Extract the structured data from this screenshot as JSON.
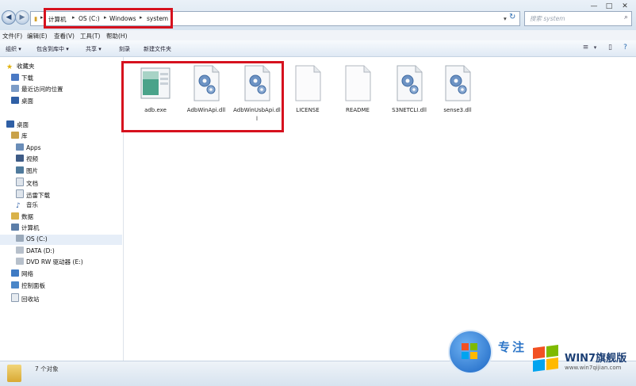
{
  "address": {
    "crumbs": [
      "计算机",
      "OS (C:)",
      "Windows",
      "system"
    ]
  },
  "search": {
    "placeholder": "搜索 system"
  },
  "menu": [
    "文件(F)",
    "编辑(E)",
    "查看(V)",
    "工具(T)",
    "帮助(H)"
  ],
  "toolbar": {
    "organize": "组织 ▾",
    "include": "包含到库中 ▾",
    "share": "共享 ▾",
    "burn": "刻录",
    "newfolder": "新建文件夹"
  },
  "sidebar": {
    "favorites": "收藏夹",
    "fav_items": [
      "下载",
      "最近访问的位置",
      "桌面"
    ],
    "desktop": "桌面",
    "libraries": "库",
    "lib_items": [
      "Apps",
      "视频",
      "图片",
      "文档",
      "迅雷下载",
      "音乐"
    ],
    "user": "数据",
    "computer": "计算机",
    "drives": [
      "OS (C:)",
      "DATA (D:)",
      "DVD RW 驱动器 (E:)"
    ],
    "network": "网络",
    "control_panel": "控制面板",
    "recycle": "回收站"
  },
  "files": [
    {
      "name": "adb.exe",
      "icon": "exe-app-icon"
    },
    {
      "name": "AdbWinApi.dll",
      "icon": "dll-gear-icon"
    },
    {
      "name": "AdbWinUsbApi.dll",
      "icon": "dll-gear-icon"
    },
    {
      "name": "LICENSE",
      "icon": "blank-file-icon"
    },
    {
      "name": "README",
      "icon": "blank-file-icon"
    },
    {
      "name": "S3NETCLI.dll",
      "icon": "dll-gear-icon"
    },
    {
      "name": "sense3.dll",
      "icon": "dll-gear-icon"
    }
  ],
  "status": {
    "count": "7 个对象"
  },
  "watermark": {
    "brand": "WIN7旗舰版",
    "url": "www.win7qijian.com",
    "tag": "专注"
  },
  "colors": {
    "highlight": "#d6111e",
    "accent": "#3b78c2"
  }
}
